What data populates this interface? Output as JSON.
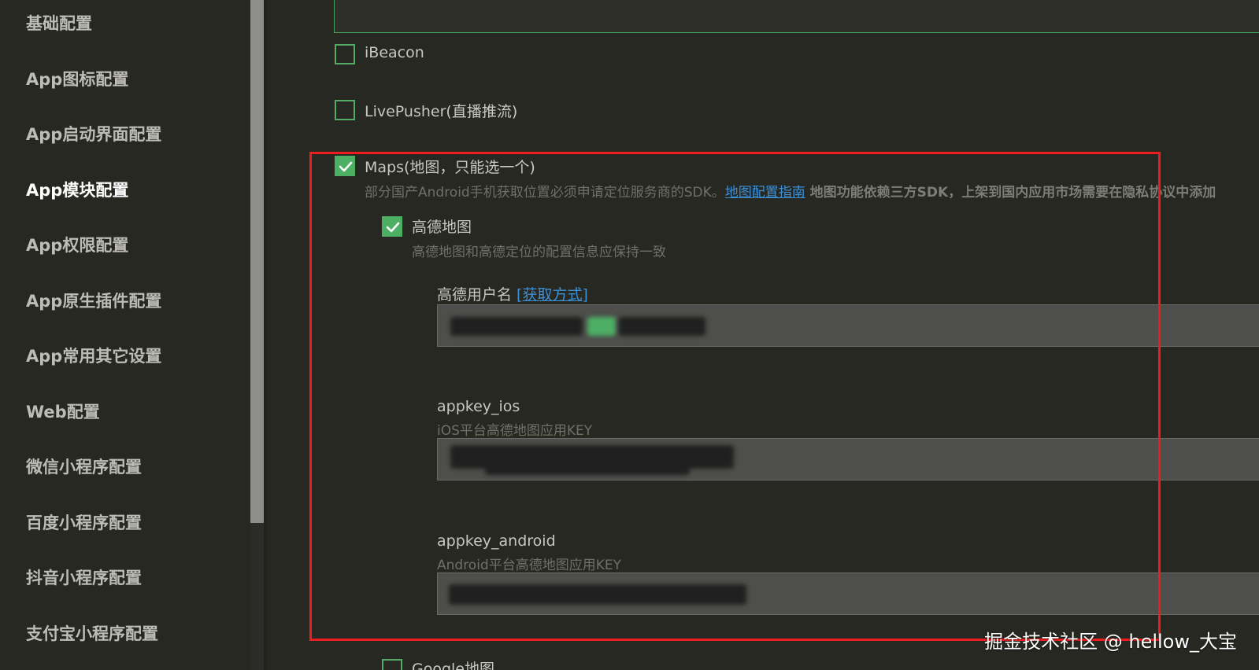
{
  "sidebar": {
    "items": [
      {
        "label": "基础配置",
        "active": false
      },
      {
        "label": "App图标配置",
        "active": false
      },
      {
        "label": "App启动界面配置",
        "active": false
      },
      {
        "label": "App模块配置",
        "active": true
      },
      {
        "label": "App权限配置",
        "active": false
      },
      {
        "label": "App原生插件配置",
        "active": false
      },
      {
        "label": "App常用其它设置",
        "active": false
      },
      {
        "label": "Web配置",
        "active": false
      },
      {
        "label": "微信小程序配置",
        "active": false
      },
      {
        "label": "百度小程序配置",
        "active": false
      },
      {
        "label": "抖音小程序配置",
        "active": false
      },
      {
        "label": "支付宝小程序配置",
        "active": false
      }
    ]
  },
  "modules": {
    "ibeacon": {
      "label": "iBeacon",
      "checked": false
    },
    "livepusher": {
      "label": "LivePusher(直播推流)",
      "checked": false
    },
    "maps": {
      "label": "Maps(地图，只能选一个)",
      "checked": true,
      "desc_prefix": "部分国产Android手机获取位置必须申请定位服务商的SDK。",
      "desc_link": "地图配置指南",
      "desc_bold": " 地图功能依赖三方SDK，上架到国内应用市场需要在隐私协议中添加"
    },
    "amap": {
      "label": "高德地图",
      "checked": true,
      "desc": "高德地图和高德定位的配置信息应保持一致"
    },
    "google": {
      "label": "Google地图",
      "checked": false
    }
  },
  "fields": {
    "username": {
      "label": "高德用户名 ",
      "link": "[获取方式]"
    },
    "appkey_ios": {
      "label": "appkey_ios",
      "desc": "iOS平台高德地图应用KEY"
    },
    "appkey_android": {
      "label": "appkey_android",
      "desc": "Android平台高德地图应用KEY"
    }
  },
  "watermark": "掘金技术社区 @ hellow_大宝",
  "colors": {
    "background": "#272822",
    "accent": "#4caf64",
    "link": "#3d8fd6",
    "highlight": "#ee1c1c"
  }
}
